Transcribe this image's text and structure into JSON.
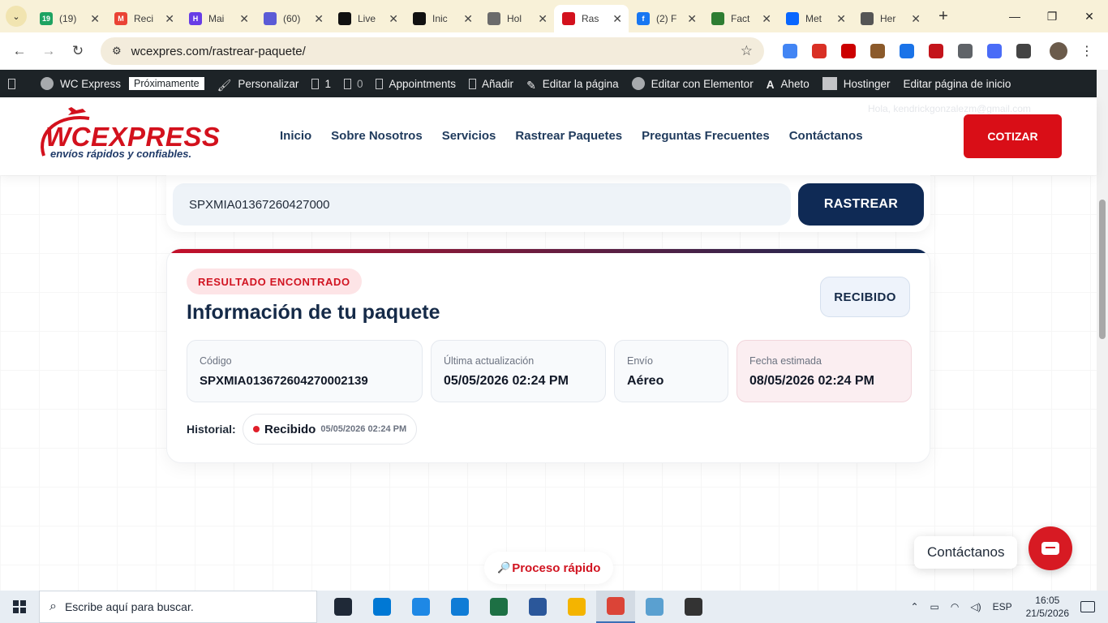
{
  "browser": {
    "tabs": [
      {
        "label": "(19)",
        "favicon": "#1ea362",
        "badge": "19"
      },
      {
        "label": "Reci",
        "favicon": "#ea4335",
        "badge": "M"
      },
      {
        "label": "Mai",
        "favicon": "#673de6",
        "badge": "H"
      },
      {
        "label": "(60)",
        "favicon": "#5b5bd6",
        "badge": ""
      },
      {
        "label": "Live",
        "favicon": "#111111",
        "badge": ""
      },
      {
        "label": "Inic",
        "favicon": "#111111",
        "badge": ""
      },
      {
        "label": "Hol",
        "favicon": "#6b6b6b",
        "badge": ""
      },
      {
        "label": "Ras",
        "favicon": "#d3111d",
        "badge": "",
        "active": true
      },
      {
        "label": "(2) F",
        "favicon": "#1877f2",
        "badge": "f"
      },
      {
        "label": "Fact",
        "favicon": "#2e7d32",
        "badge": ""
      },
      {
        "label": "Met",
        "favicon": "#0866ff",
        "badge": ""
      },
      {
        "label": "Her",
        "favicon": "#555555",
        "badge": ""
      }
    ],
    "url": "wcexpres.com/rastrear-paquete/",
    "extensions": [
      "#4285f4",
      "#d93025",
      "#cc0000",
      "#8b5a2b",
      "#1a73e8",
      "#c4141b",
      "#5f6368",
      "#4a6cf7",
      "#444444"
    ]
  },
  "wp_admin": {
    "site": "WC Express",
    "badge": "Próximamente",
    "customize": "Personalizar",
    "comments": "1",
    "new": "0",
    "appointments": "Appointments",
    "add": "Añadir",
    "edit_page": "Editar la página",
    "elementor": "Editar con Elementor",
    "aheto": "Aheto",
    "hostinger": "Hostinger",
    "edit_home": "Editar página de inicio"
  },
  "site": {
    "logo_text": "WCEXPRESS",
    "logo_sub": "envíos  rápidos y confiables.",
    "nav": [
      "Inicio",
      "Sobre Nosotros",
      "Servicios",
      "Rastrear Paquetes",
      "Preguntas Frecuentes",
      "Contáctanos"
    ],
    "greeting": "Hola, kendrickgonzalezm@gmail.com",
    "quote_button": "COTIZAR"
  },
  "tracking": {
    "input_value": "SPXMIA01367260427000",
    "track_button": "RASTREAR"
  },
  "result": {
    "found_label": "RESULTADO ENCONTRADO",
    "title": "Información de tu paquete",
    "status": "RECIBIDO",
    "fields": [
      {
        "label": "Código",
        "value": "SPXMIA013672604270002139"
      },
      {
        "label": "Última actualización",
        "value": "05/05/2026 02:24 PM"
      },
      {
        "label": "Envío",
        "value": "Aéreo"
      },
      {
        "label": "Fecha estimada",
        "value": "08/05/2026 02:24 PM"
      }
    ],
    "history_label": "Historial:",
    "history": [
      {
        "status": "Recibido",
        "date": "05/05/2026 02:24 PM"
      }
    ]
  },
  "footer": {
    "process": "Proceso rápido",
    "contact_bubble": "Contáctanos"
  },
  "taskbar": {
    "search_placeholder": "Escribe aquí para buscar.",
    "apps": [
      "#1f2937",
      "#0078d4",
      "#1e88e5",
      "#0f7cd6",
      "#1d7044",
      "#2b579a",
      "#f4b400",
      "#db4437",
      "#5aa0d0",
      "#333333"
    ],
    "lang": "ESP",
    "time": "16:05",
    "date": "21/5/2026"
  }
}
